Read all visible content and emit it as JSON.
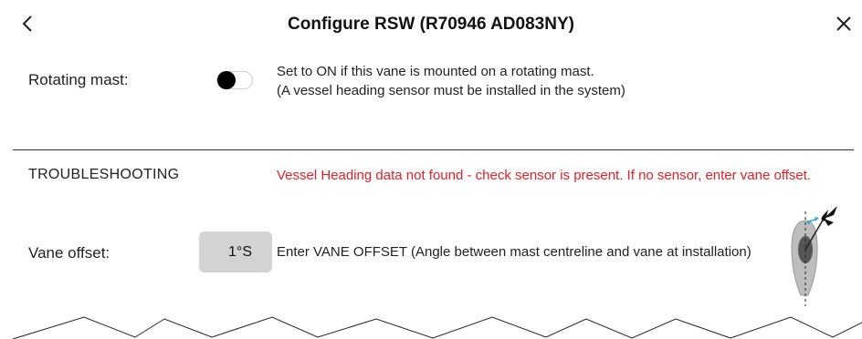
{
  "header": {
    "title": "Configure RSW (R70946 AD083NY)",
    "back_icon": "chevron-left-icon",
    "close_icon": "close-icon"
  },
  "rotating_mast": {
    "label": "Rotating mast:",
    "toggle_state": "off",
    "description_line1": "Set to ON if this vane is mounted on a rotating mast.",
    "description_line2": "(A vessel heading sensor must be installed in the system)"
  },
  "troubleshooting": {
    "title": "TROUBLESHOOTING",
    "warning": "Vessel Heading data not found - check sensor is present. If no sensor, enter vane offset."
  },
  "vane_offset": {
    "label": "Vane offset:",
    "value": "1°S",
    "description": "Enter VANE OFFSET (Angle between mast centreline and vane at installation)",
    "diagram_icon": "vane-offset-diagram-icon"
  },
  "colors": {
    "warning": "#e0212a",
    "input_bg": "#d3d3d6",
    "accent_arrow": "#3aa9e6"
  }
}
